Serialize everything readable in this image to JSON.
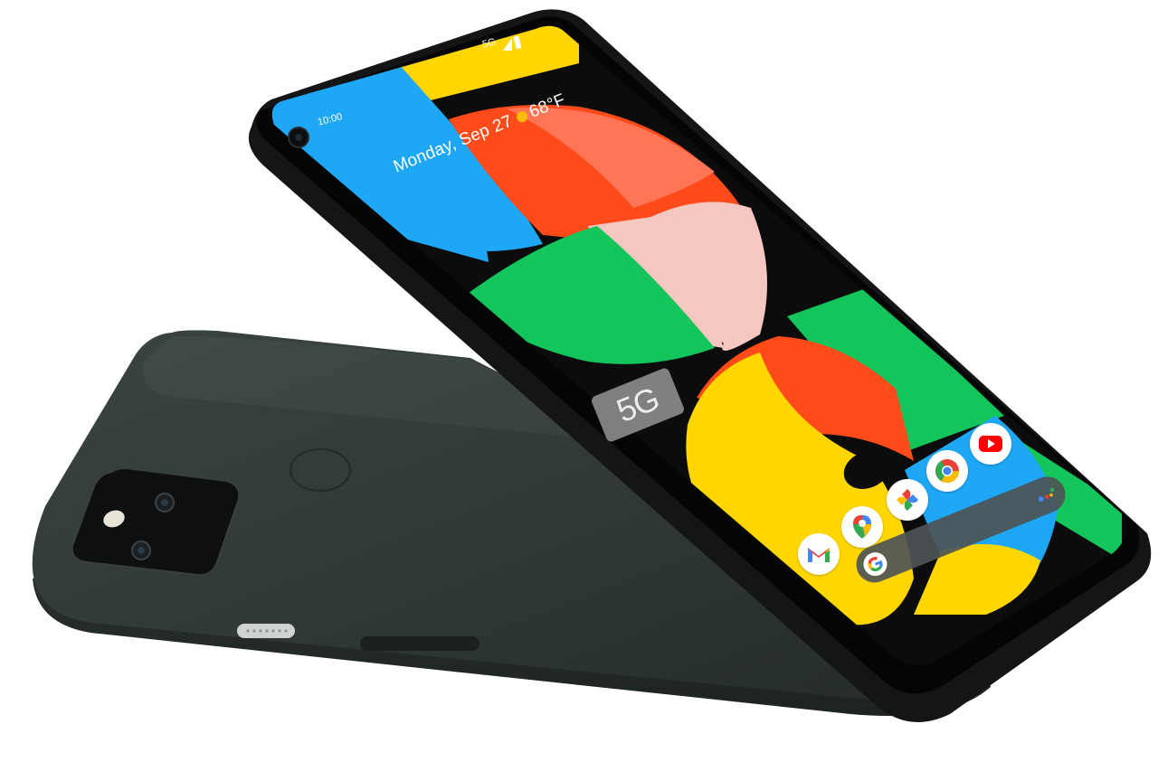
{
  "scene": {
    "background": "#ffffff"
  },
  "back_phone": {
    "body_color": "#313a34",
    "features": [
      "dual-camera-module",
      "fingerprint-sensor",
      "usb-c-port",
      "speaker-grille"
    ]
  },
  "front_phone": {
    "status_bar": {
      "time": "10:00",
      "network": "5G"
    },
    "glance": {
      "date": "Monday, Sep 27",
      "temperature": "68°F",
      "weather_icon": "sun-icon"
    },
    "wallpaper_badge": "5G",
    "wallpaper_colors": {
      "blue": "#1ea7f4",
      "yellow": "#ffd600",
      "red": "#ff4a1a",
      "green": "#13c55b",
      "pink": "#f4c8c0",
      "black": "#0c0c0c"
    },
    "dock_apps": [
      {
        "name": "Gmail",
        "icon": "gmail-icon"
      },
      {
        "name": "Maps",
        "icon": "maps-icon"
      },
      {
        "name": "Photos",
        "icon": "photos-icon"
      },
      {
        "name": "Chrome",
        "icon": "chrome-icon"
      },
      {
        "name": "YouTube",
        "icon": "youtube-icon"
      }
    ],
    "search_bar": {
      "left_icon": "google-g-icon",
      "right_icon": "assistant-icon"
    }
  }
}
